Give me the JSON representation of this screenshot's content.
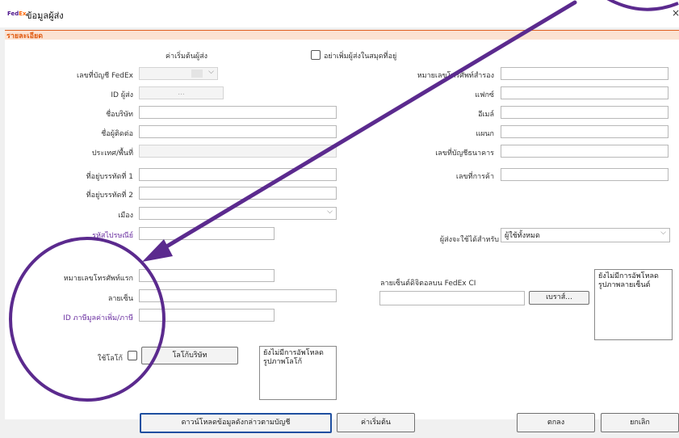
{
  "window": {
    "logo_fe": "Fed",
    "logo_ex": "Ex",
    "title": "ข้อมูลผู้ส่ง",
    "close": "×"
  },
  "section": {
    "title": "รายละเอียด"
  },
  "defaults": {
    "sender_defaults_label": "ค่าเริ่มต้นผู้ส่ง",
    "dont_add_label": "อย่าเพิ่มผู้ส่งในสมุดที่อยู่"
  },
  "left_fields": {
    "fedex_account": "เลขที่บัญชี FedEx",
    "sender_id": "ID ผู้ส่ง",
    "company": "ชื่อบริษัท",
    "contact": "ชื่อผู้ติดต่อ",
    "country": "ประเทศ/พื้นที่",
    "address1": "ที่อยู่บรรทัดที่ 1",
    "address2": "ที่อยู่บรรทัดที่ 2",
    "city": "เมือง",
    "postal": "รหัสไปรษณีย์",
    "sender_id_value": "..."
  },
  "right_fields": {
    "alt_phone": "หมายเลขโทรศัพท์สำรอง",
    "fax": "แฟกซ์",
    "email": "อีเมล์",
    "department": "แผนก",
    "bank_account": "เลขที่บัญชีธนาคาร",
    "trade_number": "เลขที่การค้า",
    "available_for": "ผู้ส่งจะใช้ได้สำหรับ",
    "available_for_value": "ผู้ใช้ทั้งหมด"
  },
  "lower": {
    "first_phone": "หมายเลขโทรศัพท์แรก",
    "signature": "ลายเซ็น",
    "tax_id": "ID ภาษีมูลค่าเพิ่ม/ภาษี",
    "use_logo": "ใช้โลโก้",
    "company_logo_button": "โลโก้บริษัท",
    "logo_preview": "ยังไม่มีการอัพโหลดรูปภาพโลโก้",
    "digital_signature": "ลายเซ็นต์ดิจิตอลบน FedEx CI",
    "browse_button": "เบราส์...",
    "signature_preview": "ยังไม่มีการอัพโหลดรูปภาพลายเซ็นต์"
  },
  "footer": {
    "download_button": "ดาวน์โหลดข้อมูลดังกล่าวตามบัญชี",
    "defaults_button": "ค่าเริ่มต้น",
    "ok_button": "ตกลง",
    "cancel_button": "ยกเลิก"
  },
  "colors": {
    "annotation": "#5b2a8e",
    "section_accent": "#e05a10",
    "purple_label": "#6a2fa0"
  }
}
